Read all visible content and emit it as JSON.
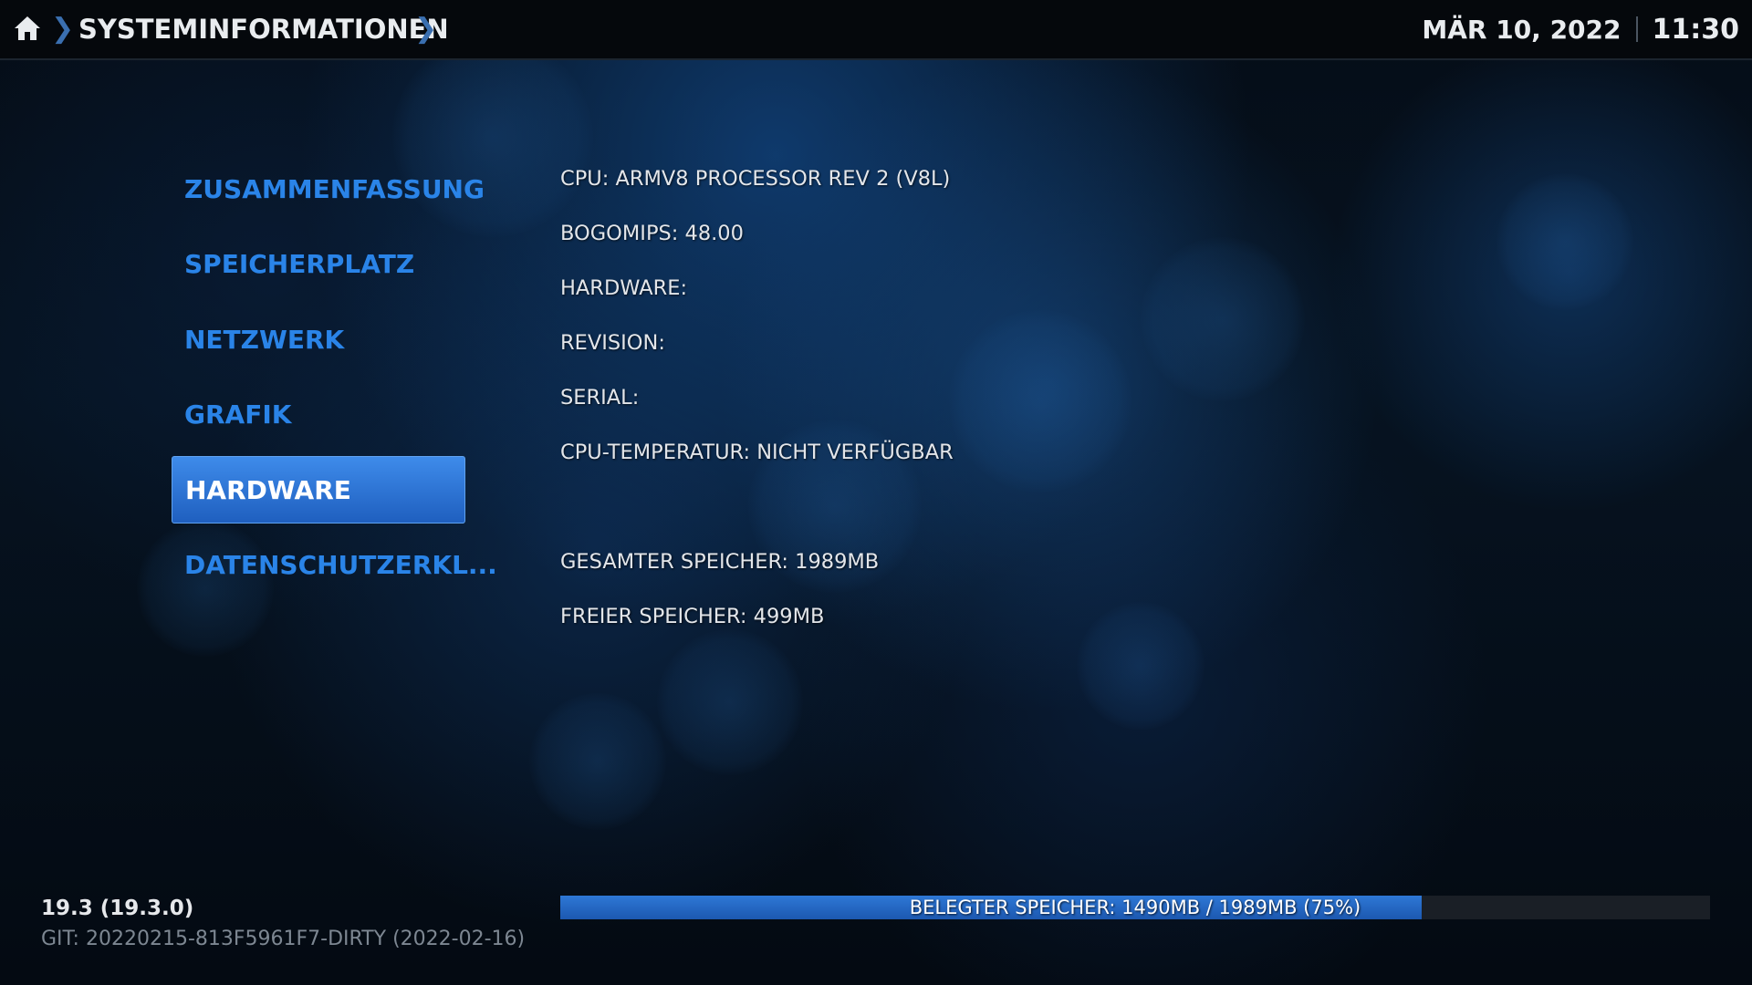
{
  "header": {
    "home_icon": "home-icon",
    "breadcrumb": "SYSTEMINFORMATIONEN",
    "date": "MÄR 10, 2022",
    "time": "11:30"
  },
  "menu": {
    "items": [
      {
        "label": "ZUSAMMENFASSUNG",
        "selected": false
      },
      {
        "label": "SPEICHERPLATZ",
        "selected": false
      },
      {
        "label": "NETZWERK",
        "selected": false
      },
      {
        "label": "GRAFIK",
        "selected": false
      },
      {
        "label": "HARDWARE",
        "selected": true
      },
      {
        "label": "DATENSCHUTZERKL...",
        "selected": false
      }
    ]
  },
  "info": {
    "cpu": "CPU: ARMV8 PROCESSOR REV 2 (V8L)",
    "bogomips": "BOGOMIPS: 48.00",
    "hardware": "HARDWARE:",
    "revision": "REVISION:",
    "serial": "SERIAL:",
    "cpu_temp": "CPU-TEMPERATUR: NICHT VERFÜGBAR",
    "total_memory": "GESAMTER SPEICHER: 1989MB",
    "free_memory": "FREIER SPEICHER: 499MB"
  },
  "footer": {
    "version": "19.3 (19.3.0)",
    "git": "GIT: 20220215-813F5961F7-DIRTY (2022-02-16)",
    "memory_bar_label": "BELEGTER SPEICHER: 1490MB / 1989MB (75%)",
    "memory_used_fraction": 0.749
  },
  "colors": {
    "accent": "#2a84e8",
    "selected_bg": "#2a70d0",
    "bar_fill": "#2468c4"
  }
}
